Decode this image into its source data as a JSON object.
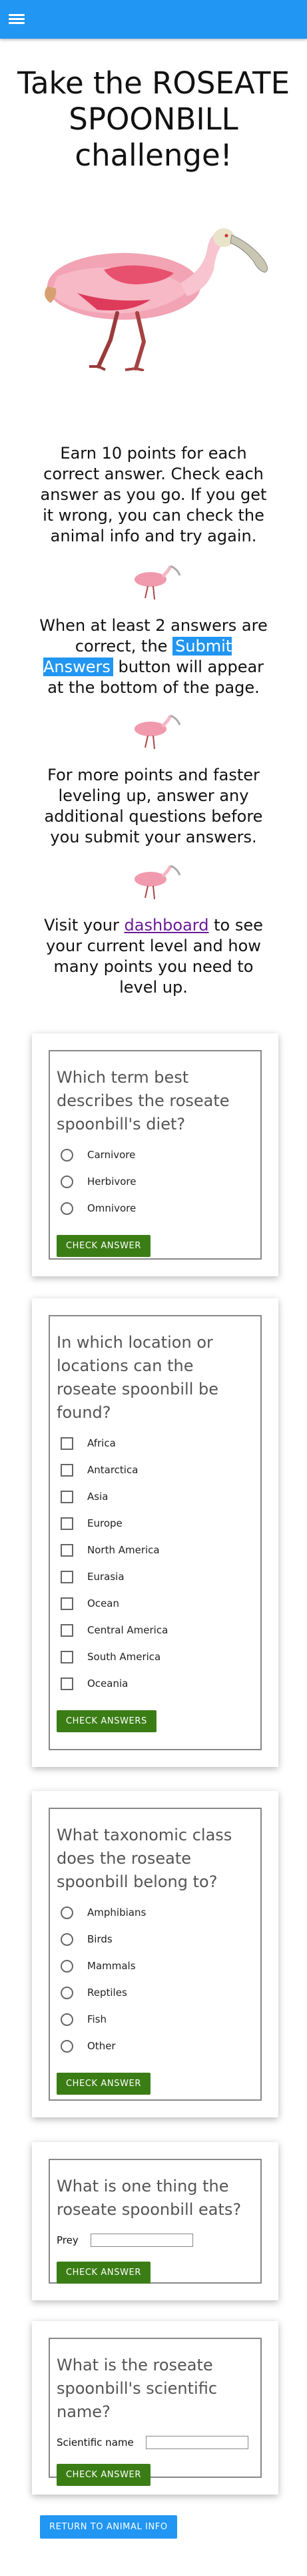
{
  "header": {
    "menu_icon": "hamburger-menu-icon"
  },
  "title": "Take the ROSEATE SPOONBILL challenge!",
  "intro": {
    "p1": "Earn 10 points for each correct answer. Check each answer as you go. If you get it wrong, you can check the animal info and try again.",
    "p2_before": "When at least 2 answers are correct, the ",
    "p2_highlight": "Submit Answers",
    "p2_after": " button will appear at the bottom of the page.",
    "p3": "For more points and faster leveling up, answer any additional questions before you submit your answers.",
    "p4_before": "Visit your ",
    "p4_link": "dashboard",
    "p4_after": " to see your current level and how many points you need to level up."
  },
  "questions": [
    {
      "text": "Which term best describes the roseate spoonbill's diet?",
      "type": "radio",
      "options": [
        "Carnivore",
        "Herbivore",
        "Omnivore"
      ],
      "button": "CHECK ANSWER"
    },
    {
      "text": "In which location or locations can the roseate spoonbill be found?",
      "type": "checkbox",
      "options": [
        "Africa",
        "Antarctica",
        "Asia",
        "Europe",
        "North America",
        "Eurasia",
        "Ocean",
        "Central America",
        "South America",
        "Oceania"
      ],
      "button": "CHECK ANSWERS"
    },
    {
      "text": "What taxonomic class does the roseate spoonbill belong to?",
      "type": "radio",
      "options": [
        "Amphibians",
        "Birds",
        "Mammals",
        "Reptiles",
        "Fish",
        "Other"
      ],
      "button": "CHECK ANSWER"
    },
    {
      "text": "What is one thing the roseate spoonbill eats?",
      "type": "text",
      "field_label": "Prey",
      "field_value": "",
      "button": "CHECK ANSWER"
    },
    {
      "text": "What is the roseate spoonbill's scientific name?",
      "type": "text",
      "field_label": "Scientific name",
      "field_value": "",
      "button": "CHECK ANSWER"
    }
  ],
  "footer": {
    "back_button": "RETURN TO ANIMAL INFO"
  },
  "colors": {
    "primary": "#2196f3",
    "button_green": "#3b7d15",
    "link": "#6a1b9a"
  }
}
